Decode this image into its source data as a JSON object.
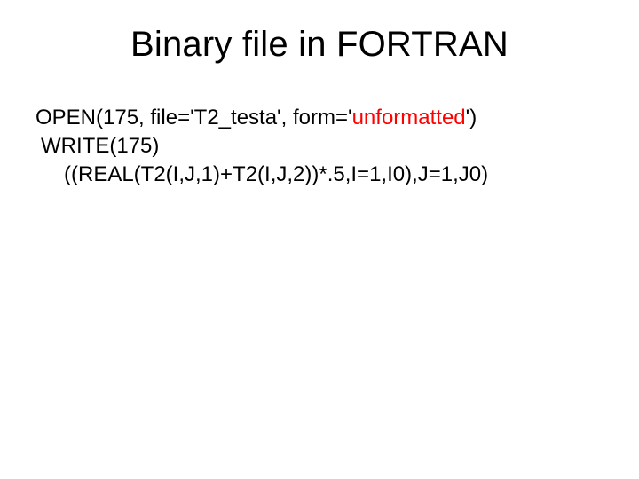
{
  "title": "Binary file in FORTRAN",
  "code": {
    "line1_pre": "OPEN(175, file='T2_testa', form='",
    "line1_hl": "unformatted",
    "line1_post": "')",
    "line2": "WRITE(175)",
    "line3": "((REAL(T2(I,J,1)+T2(I,J,2))*.5,I=1,I0),J=1,J0)"
  }
}
